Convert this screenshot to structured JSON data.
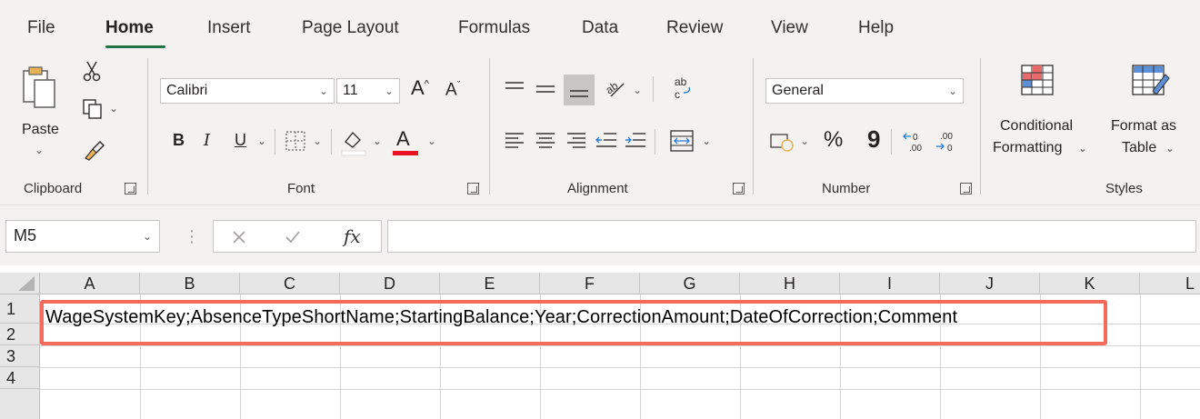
{
  "tabs": [
    {
      "label": "File",
      "active": false
    },
    {
      "label": "Home",
      "active": true
    },
    {
      "label": "Insert",
      "active": false
    },
    {
      "label": "Page Layout",
      "active": false
    },
    {
      "label": "Formulas",
      "active": false
    },
    {
      "label": "Data",
      "active": false
    },
    {
      "label": "Review",
      "active": false
    },
    {
      "label": "View",
      "active": false
    },
    {
      "label": "Help",
      "active": false
    }
  ],
  "ribbon": {
    "clipboard": {
      "label": "Clipboard",
      "paste_label": "Paste"
    },
    "font": {
      "label": "Font",
      "font_name": "Calibri",
      "font_size": "11",
      "bold": "B",
      "italic": "I",
      "underline": "U"
    },
    "alignment": {
      "label": "Alignment"
    },
    "number": {
      "label": "Number",
      "format": "General",
      "percent": "%",
      "comma": "9"
    },
    "styles": {
      "label": "Styles",
      "conditional_line1": "Conditional",
      "conditional_line2": "Formatting",
      "format_table_line1": "Format as",
      "format_table_line2": "Table"
    }
  },
  "formula_bar": {
    "name_box": "M5",
    "formula": "",
    "fx": "fx"
  },
  "sheet": {
    "columns": [
      "A",
      "B",
      "C",
      "D",
      "E",
      "F",
      "G",
      "H",
      "I",
      "J",
      "K",
      "L"
    ],
    "rows": [
      "1",
      "2",
      "3",
      "4"
    ],
    "cells": {
      "A1": "WageSystemKey;AbsenceTypeShortName;StartingBalance;Year;CorrectionAmount;DateOfCorrection;Comment"
    }
  },
  "colors": {
    "accent": "#217346",
    "highlight": "#f26b5b",
    "font_color_bar": "#e81123"
  }
}
